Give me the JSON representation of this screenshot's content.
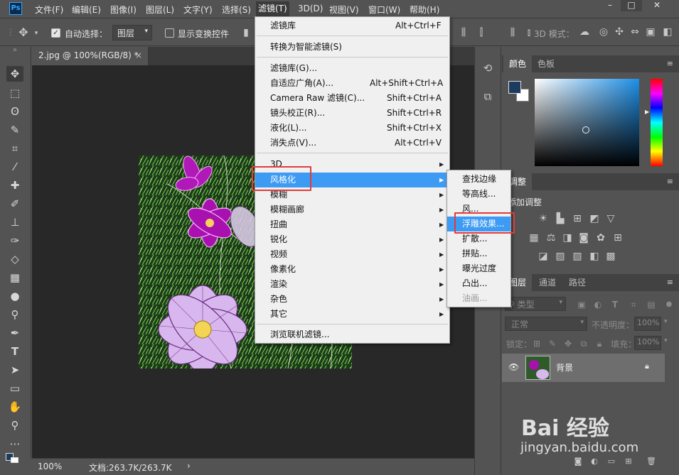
{
  "menubar": {
    "logo": "Ps",
    "items": [
      "文件(F)",
      "编辑(E)",
      "图像(I)",
      "图层(L)",
      "文字(Y)",
      "选择(S)",
      "滤镜(T)",
      "3D(D)",
      "视图(V)",
      "窗口(W)",
      "帮助(H)"
    ],
    "active_item": "滤镜(T)",
    "window_controls": [
      "–",
      "□",
      "✕"
    ]
  },
  "options": {
    "auto_select_label": "自动选择：",
    "auto_select_value": "图层",
    "show_transform_label": "显示变换控件",
    "mode_3d_label": "3D 模式："
  },
  "document": {
    "tab_title": "2.jpg @ 100%(RGB/8) *",
    "close_glyph": "×"
  },
  "status": {
    "zoom": "100%",
    "doc_size": "文档:263.7K/263.7K",
    "arrow": "›"
  },
  "filter_menu": {
    "items": [
      {
        "label": "滤镜库",
        "shortcut": "Alt+Ctrl+F"
      },
      {
        "label": "转换为智能滤镜(S)"
      },
      {
        "label": "滤镜库(G)..."
      },
      {
        "label": "自适应广角(A)...",
        "shortcut": "Alt+Shift+Ctrl+A"
      },
      {
        "label": "Camera Raw 滤镜(C)...",
        "shortcut": "Shift+Ctrl+A"
      },
      {
        "label": "镜头校正(R)...",
        "shortcut": "Shift+Ctrl+R"
      },
      {
        "label": "液化(L)...",
        "shortcut": "Shift+Ctrl+X"
      },
      {
        "label": "消失点(V)...",
        "shortcut": "Alt+Ctrl+V"
      },
      {
        "label": "3D"
      },
      {
        "label": "风格化"
      },
      {
        "label": "模糊"
      },
      {
        "label": "模糊画廊"
      },
      {
        "label": "扭曲"
      },
      {
        "label": "锐化"
      },
      {
        "label": "视频"
      },
      {
        "label": "像素化"
      },
      {
        "label": "渲染"
      },
      {
        "label": "杂色"
      },
      {
        "label": "其它"
      },
      {
        "label": "浏览联机滤镜..."
      }
    ],
    "highlighted": "风格化"
  },
  "stylize_submenu": {
    "items": [
      "查找边缘",
      "等高线...",
      "风...",
      "浮雕效果...",
      "扩散...",
      "拼贴...",
      "曝光过度",
      "凸出...",
      "油画..."
    ],
    "highlighted": "浮雕效果...",
    "disabled": "油画..."
  },
  "panels": {
    "color_tabs": [
      "颜色",
      "色板"
    ],
    "adjust_tab": "调整",
    "adjust_title": "添加调整",
    "layer_tabs": [
      "图层",
      "通道",
      "路径"
    ],
    "kind_label": "类型",
    "blend_mode": "正常",
    "opacity_label": "不透明度：",
    "opacity_value": "100%",
    "lock_label": "锁定：",
    "fill_label": "填充：",
    "fill_value": "100%",
    "layer_name": "背景"
  },
  "colors": {
    "foreground": "#1d3a5f",
    "background": "#ffffff",
    "menu_highlight": "#3e9bf3",
    "annotation_red": "#e23b3b"
  },
  "watermark": {
    "logo": "Bai 经验",
    "url": "jingyan.baidu.com"
  }
}
